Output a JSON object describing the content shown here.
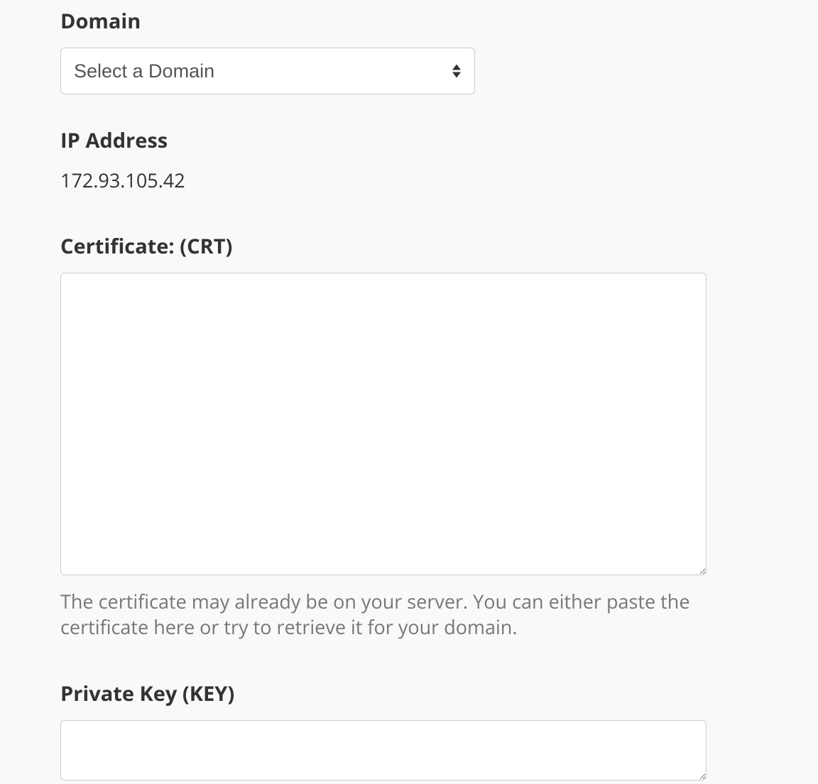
{
  "domain": {
    "label": "Domain",
    "placeholder": "Select a Domain"
  },
  "ip": {
    "label": "IP Address",
    "value": "172.93.105.42"
  },
  "certificate": {
    "label": "Certificate: (CRT)",
    "value": "",
    "help": "The certificate may already be on your server. You can either paste the certificate here or try to retrieve it for your domain."
  },
  "privateKey": {
    "label": "Private Key (KEY)",
    "value": ""
  }
}
